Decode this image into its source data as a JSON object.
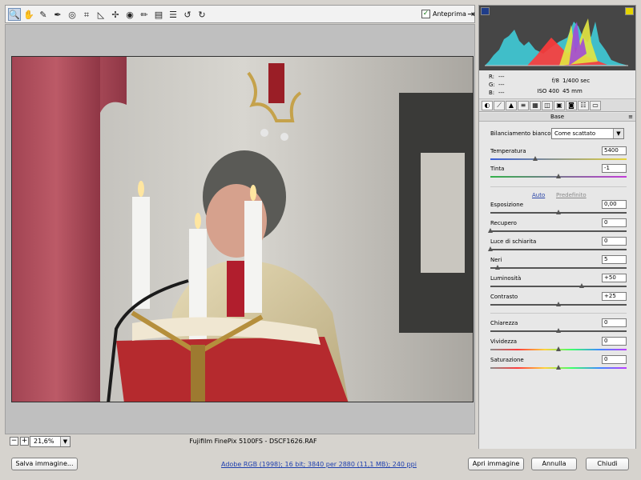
{
  "toolbar": {
    "tools": [
      {
        "icon": "zoom-icon",
        "glyph": "🔍",
        "active": true
      },
      {
        "icon": "hand-icon",
        "glyph": "✋"
      },
      {
        "icon": "white-balance-icon",
        "glyph": "✎"
      },
      {
        "icon": "color-sampler-icon",
        "glyph": "✒"
      },
      {
        "icon": "target-adjustment-icon",
        "glyph": "◎"
      },
      {
        "icon": "crop-icon",
        "glyph": "⌗"
      },
      {
        "icon": "straighten-icon",
        "glyph": "◺"
      },
      {
        "icon": "spot-removal-icon",
        "glyph": "✢"
      },
      {
        "icon": "red-eye-icon",
        "glyph": "◉"
      },
      {
        "icon": "adjustment-brush-icon",
        "glyph": "✏"
      },
      {
        "icon": "graduated-filter-icon",
        "glyph": "▤"
      },
      {
        "icon": "preferences-icon",
        "glyph": "☰"
      },
      {
        "icon": "rotate-left-icon",
        "glyph": "↺"
      },
      {
        "icon": "rotate-right-icon",
        "glyph": "↻"
      }
    ],
    "preview_label": "Anteprima",
    "preview_checked": true
  },
  "status": {
    "zoom_minus": "−",
    "zoom_plus": "+",
    "zoom_value": "21,6%",
    "filename": "Fujifilm FinePix 5100FS  -  DSCF1626.RAF"
  },
  "readouts": {
    "r_label": "R:",
    "r_value": "---",
    "g_label": "G:",
    "g_value": "---",
    "b_label": "B:",
    "b_value": "---",
    "aperture": "f/8",
    "shutter": "1/400 sec",
    "iso": "ISO 400",
    "focal": "45 mm"
  },
  "panel": {
    "section_title": "Base",
    "section_menu": "≡",
    "wb_label": "Bilanciamento bianco:",
    "wb_value": "Come scattato",
    "auto_label": "Auto",
    "default_label": "Predefinito"
  },
  "controls": [
    {
      "key": "temperature",
      "label": "Temperatura",
      "value": "5400",
      "level": 0.33,
      "track": "temp"
    },
    {
      "key": "tint",
      "label": "Tinta",
      "value": "-1",
      "level": 0.5,
      "track": "tint"
    },
    {
      "key": "exposure",
      "label": "Esposizione",
      "value": "0,00",
      "level": 0.5,
      "track": "plain"
    },
    {
      "key": "recovery",
      "label": "Recupero",
      "value": "0",
      "level": 0.0,
      "track": "plain"
    },
    {
      "key": "fill-light",
      "label": "Luce di schiarita",
      "value": "0",
      "level": 0.0,
      "track": "plain"
    },
    {
      "key": "blacks",
      "label": "Neri",
      "value": "5",
      "level": 0.05,
      "track": "plain"
    },
    {
      "key": "brightness",
      "label": "Luminosità",
      "value": "+50",
      "level": 0.67,
      "track": "plain"
    },
    {
      "key": "contrast",
      "label": "Contrasto",
      "value": "+25",
      "level": 0.5,
      "track": "plain"
    },
    {
      "key": "clarity",
      "label": "Chiarezza",
      "value": "0",
      "level": 0.5,
      "track": "plain"
    },
    {
      "key": "vibrance",
      "label": "Vividezza",
      "value": "0",
      "level": 0.5,
      "track": "vib"
    },
    {
      "key": "saturation",
      "label": "Saturazione",
      "value": "0",
      "level": 0.5,
      "track": "sat"
    }
  ],
  "buttons": {
    "save": "Salva immagine...",
    "open": "Apri immagine",
    "cancel": "Annulla",
    "close": "Chiudi"
  },
  "workflow_link": "Adobe RGB (1998); 16 bit; 3840 per 2880 (11,1 MB); 240 ppi",
  "colors": {
    "temp_track": "linear-gradient(90deg,#3a5fd8,#e7d43c)",
    "tint_track": "linear-gradient(90deg,#33b24a,#c23bd8)",
    "vib_track": "linear-gradient(90deg,#8a8a8a,#ff3d3d,#ffd23d,#3dff6a,#3d8bff,#c03dff)",
    "sat_track": "linear-gradient(90deg,#8a8a8a,#ff3d3d,#ffd23d,#3dff6a,#3d8bff,#c03dff)"
  }
}
